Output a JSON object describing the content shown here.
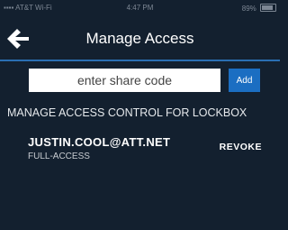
{
  "status_bar": {
    "carrier": "AT&T Wi-Fi",
    "time": "4:47 PM",
    "battery": "89%"
  },
  "header": {
    "title": "Manage Access",
    "back_icon": "arrow-left-icon"
  },
  "share": {
    "placeholder": "enter share code",
    "value": "",
    "add_label": "Add"
  },
  "section": {
    "title": "MANAGE ACCESS CONTROL FOR LOCKBOX"
  },
  "access_list": [
    {
      "email": "JUSTIN.COOL@ATT.NET",
      "level": "FULL-ACCESS",
      "action_label": "REVOKE"
    }
  ],
  "colors": {
    "background": "#13202f",
    "accent": "#1b6ec2",
    "divider": "#2a6fb3"
  }
}
